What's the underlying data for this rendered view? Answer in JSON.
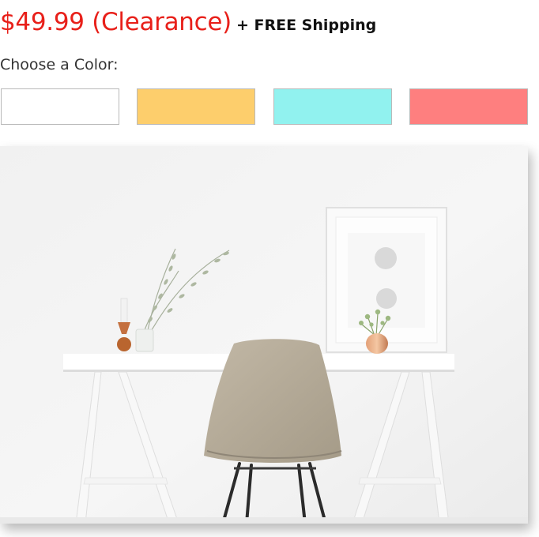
{
  "product": {
    "price": "$49.99 (Clearance)",
    "shipping": "+ FREE Shipping",
    "price_color": "#e8201a"
  },
  "color_picker": {
    "label": "Choose a Color:",
    "options": [
      {
        "name": "White",
        "hex": "#ffffff"
      },
      {
        "name": "Yellow",
        "hex": "#fdce6c"
      },
      {
        "name": "Aqua",
        "hex": "#91f2ef"
      },
      {
        "name": "Coral",
        "hex": "#fe7f7f"
      }
    ]
  },
  "photo": {
    "subject": "desk-with-chair"
  }
}
